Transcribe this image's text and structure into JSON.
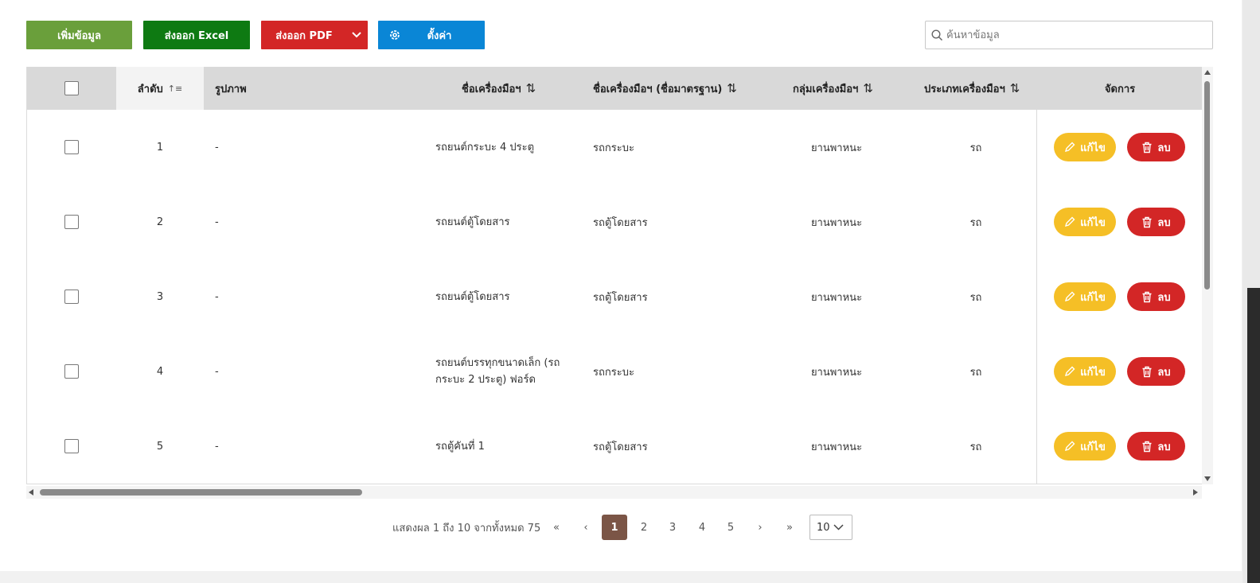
{
  "toolbar": {
    "add_label": "เพิ่มข้อมูล",
    "excel_label": "ส่งออก Excel",
    "pdf_label": "ส่งออก PDF",
    "settings_label": "ตั้งค่า",
    "search_placeholder": "ค้นหาข้อมูล",
    "search_value": ""
  },
  "table": {
    "headers": {
      "order": "ลำดับ",
      "image": "รูปภาพ",
      "tool_name": "ชื่อเครื่องมือฯ",
      "tool_name_std": "ชื่อเครื่องมือฯ (ชื่อมาตรฐาน)",
      "tool_group": "กลุ่มเครื่องมือฯ",
      "tool_type": "ประเภทเครื่องมือฯ",
      "manage": "จัดการ"
    },
    "sort_icon": "⇅",
    "sort_asc_icon": "↑≡",
    "edit_label": "แก้ไข",
    "delete_label": "ลบ",
    "rows": [
      {
        "order": "1",
        "image": "-",
        "tool_name": "รถยนต์กระบะ 4 ประตู",
        "tool_name_std": "รถกระบะ",
        "tool_group": "ยานพาหนะ",
        "tool_type": "รถ"
      },
      {
        "order": "2",
        "image": "-",
        "tool_name": "รถยนต์ตู้โดยสาร",
        "tool_name_std": "รถตู้โดยสาร",
        "tool_group": "ยานพาหนะ",
        "tool_type": "รถ"
      },
      {
        "order": "3",
        "image": "-",
        "tool_name": "รถยนต์ตู้โดยสาร",
        "tool_name_std": "รถตู้โดยสาร",
        "tool_group": "ยานพาหนะ",
        "tool_type": "รถ"
      },
      {
        "order": "4",
        "image": "-",
        "tool_name": "รถยนต์บรรทุกขนาดเล็ก (รถกระบะ 2 ประตู) ฟอร์ด",
        "tool_name_std": "รถกระบะ",
        "tool_group": "ยานพาหนะ",
        "tool_type": "รถ"
      },
      {
        "order": "5",
        "image": "-",
        "tool_name": "รถตู้คันที่ 1",
        "tool_name_std": "รถตู้โดยสาร",
        "tool_group": "ยานพาหนะ",
        "tool_type": "รถ"
      }
    ]
  },
  "pagination": {
    "info": "แสดงผล 1 ถึง 10 จากทั้งหมด 75",
    "first": "«",
    "prev": "‹",
    "pages": [
      "1",
      "2",
      "3",
      "4",
      "5"
    ],
    "next": "›",
    "last": "»",
    "page_size": "10"
  },
  "colors": {
    "add": "#6a9f3b",
    "excel": "#0e7a12",
    "pdf": "#d32626",
    "settings": "#0a86d6",
    "edit": "#f5bf26",
    "delete": "#d32626",
    "active_page": "#7b5546"
  }
}
